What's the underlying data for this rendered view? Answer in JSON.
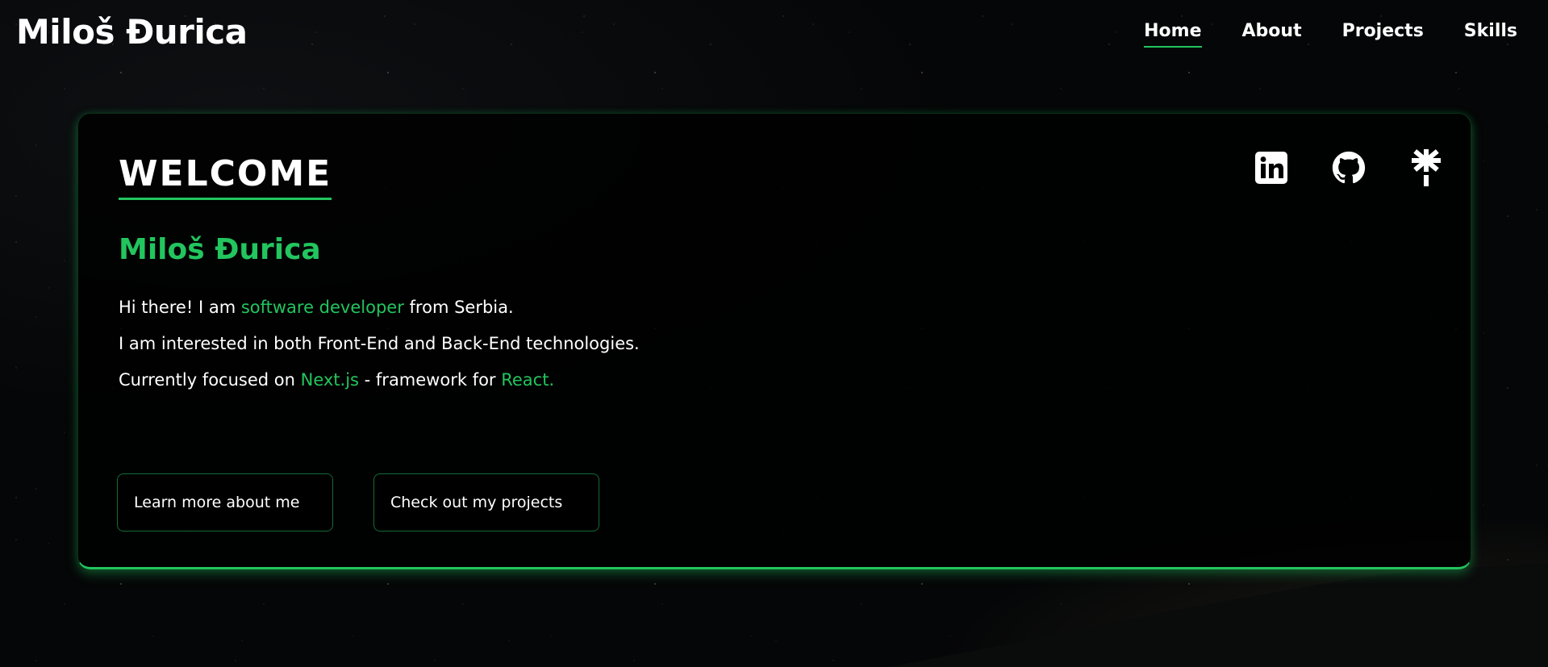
{
  "brand": {
    "name": "Miloš Đurica"
  },
  "nav": {
    "items": [
      {
        "label": "Home",
        "active": true
      },
      {
        "label": "About",
        "active": false
      },
      {
        "label": "Projects",
        "active": false
      },
      {
        "label": "Skills",
        "active": false
      }
    ]
  },
  "hero": {
    "heading": "WELCOME",
    "name": "Miloš Đurica",
    "line1": {
      "prefix": "Hi there! I am ",
      "highlight": "software developer",
      "suffix": " from Serbia."
    },
    "line2": "I am interested in both Front-End and Back-End technologies.",
    "line3": {
      "prefix": "Currently focused on ",
      "highlight1": "Next.js",
      "middle": " - framework for ",
      "highlight2": "React."
    },
    "buttons": {
      "about": "Learn more about me",
      "projects": "Check out my projects"
    },
    "socials": [
      {
        "icon": "linkedin-icon"
      },
      {
        "icon": "github-icon"
      },
      {
        "icon": "linktree-icon"
      }
    ]
  },
  "colors": {
    "accent": "#22c55e",
    "background": "#050607",
    "text": "#ffffff"
  }
}
